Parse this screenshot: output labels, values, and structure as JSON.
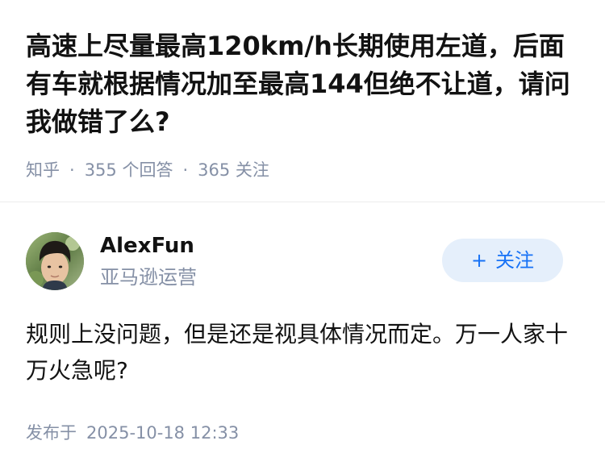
{
  "question": {
    "title": "高速上尽量最高120km/h长期使用左道，后面有车就根据情况加至最高144但绝不让道，请问我做错了么?",
    "source": "知乎",
    "answers_count": "355 个回答",
    "followers_count": "365 关注"
  },
  "author": {
    "avatar": "avatar-photo",
    "name": "AlexFun",
    "bio": "亚马逊运营",
    "follow_label": "关注",
    "follow_icon": "plus-icon"
  },
  "answer": {
    "text": "规则上没问题，但是还是视具体情况而定。万一人家十万火急呢?"
  },
  "footer": {
    "published_label": "发布于",
    "published_time": "2025-10-18 12:33"
  },
  "colors": {
    "text": "#121212",
    "muted": "#8590a6",
    "accent": "#1772f6",
    "accent_bg": "#e5effb"
  }
}
